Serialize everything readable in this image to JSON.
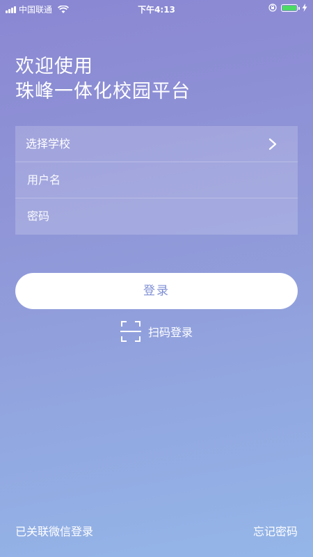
{
  "status_bar": {
    "carrier": "中国联通",
    "time": "下午4:13",
    "battery_level": 1.0
  },
  "title": {
    "line1": "欢迎使用",
    "line2": "珠峰一体化校园平台"
  },
  "form": {
    "school_label": "选择学校",
    "username_placeholder": "用户名",
    "password_placeholder": "密码"
  },
  "login_button": "登录",
  "scan_login": "扫码登录",
  "footer": {
    "wechat_login": "已关联微信登录",
    "forgot_password": "忘记密码"
  },
  "colors": {
    "accent": "#7f8fd4",
    "battery": "#4cd964"
  },
  "icons": [
    "signal-icon",
    "wifi-icon",
    "rotation-lock-icon",
    "battery-icon",
    "charging-icon",
    "chevron-right-icon",
    "scan-icon"
  ]
}
